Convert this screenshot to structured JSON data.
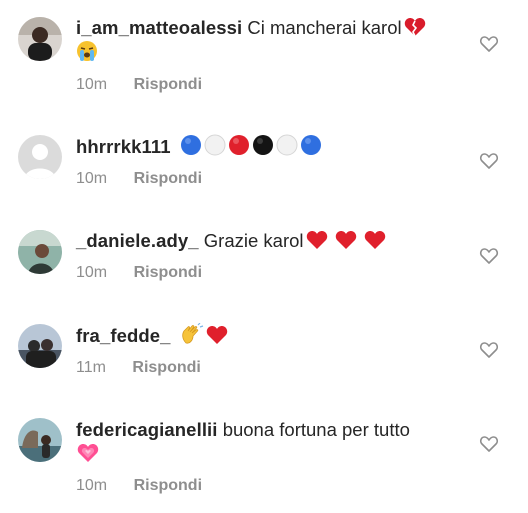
{
  "comments": [
    {
      "username": "i_am_matteoalessi",
      "text": "Ci mancherai karol",
      "emojis": [
        "broken-heart",
        "loudly-crying-face"
      ],
      "time": "10m",
      "reply_label": "Rispondi",
      "avatar": "default-photo"
    },
    {
      "username": "hhrrrkk111",
      "text": "",
      "emojis": [
        "blue-circle",
        "white-circle",
        "red-circle",
        "black-circle",
        "white-circle",
        "blue-circle"
      ],
      "time": "10m",
      "reply_label": "Rispondi",
      "avatar": "placeholder"
    },
    {
      "username": "_daniele.ady_",
      "text": "Grazie karol",
      "emojis": [
        "red-heart",
        "red-heart",
        "red-heart"
      ],
      "time": "10m",
      "reply_label": "Rispondi",
      "avatar": "photo"
    },
    {
      "username": "fra_fedde_",
      "text": "",
      "emojis": [
        "waving-hand",
        "red-heart"
      ],
      "time": "11m",
      "reply_label": "Rispondi",
      "avatar": "photo"
    },
    {
      "username": "federicagianellii",
      "text": "buona fortuna per tutto",
      "emojis": [
        "growing-heart"
      ],
      "time": "10m",
      "reply_label": "Rispondi",
      "avatar": "photo"
    }
  ],
  "colors": {
    "text": "#262626",
    "secondary": "#8e8e8e",
    "heart_red": "#e0202c",
    "blue": "#2f6fe0",
    "pink": "#ff4f93"
  }
}
